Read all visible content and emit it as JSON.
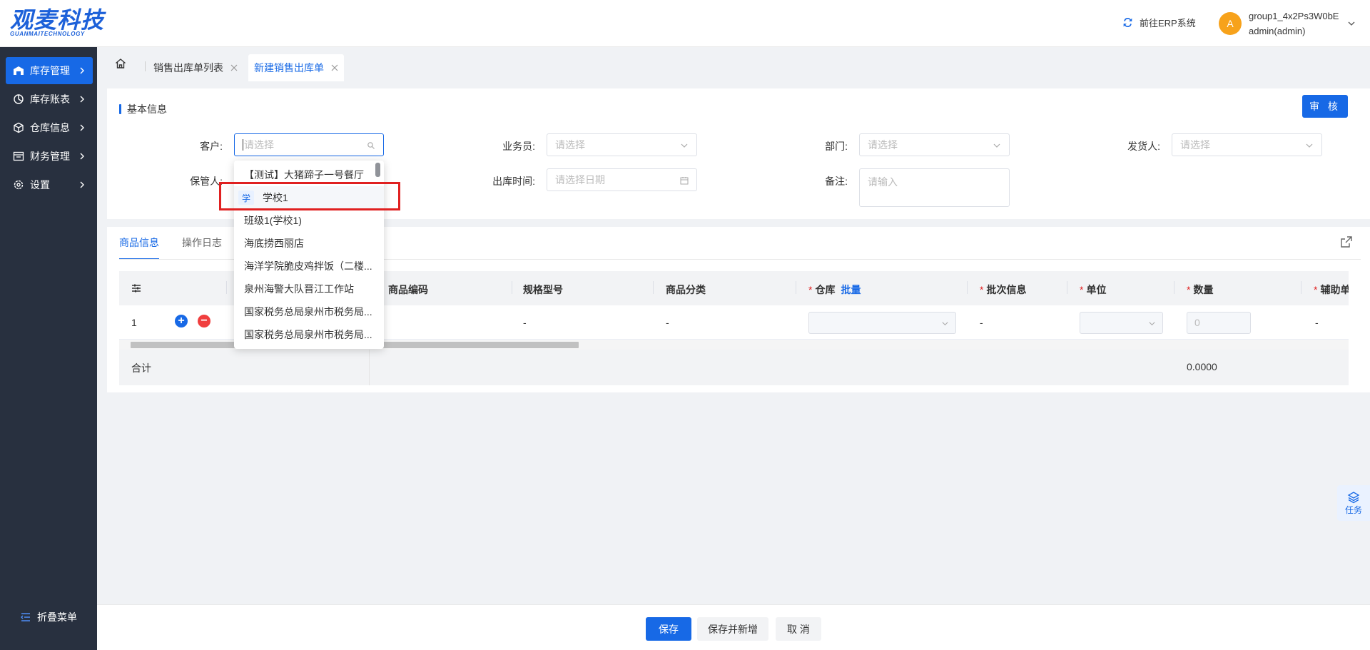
{
  "header": {
    "logo_text": "观麦科技",
    "logo_sub": "GUANMAITECHNOLOGY",
    "erp_link": "前往ERP系统",
    "avatar_letter": "A",
    "user_group": "group1_4x2Ps3W0bE",
    "user_name": "admin(admin)"
  },
  "sidebar": {
    "items": [
      {
        "label": "库存管理",
        "icon": "warehouse-icon",
        "active": true
      },
      {
        "label": "库存账表",
        "icon": "pie-chart-icon",
        "active": false
      },
      {
        "label": "仓库信息",
        "icon": "cube-icon",
        "active": false
      },
      {
        "label": "财务管理",
        "icon": "finance-icon",
        "active": false
      },
      {
        "label": "设置",
        "icon": "gear-icon",
        "active": false
      }
    ],
    "collapse_label": "折叠菜单"
  },
  "tabs": [
    {
      "label": "销售出库单列表",
      "active": false
    },
    {
      "label": "新建销售出库单",
      "active": true
    }
  ],
  "basic_info": {
    "title": "基本信息",
    "audit_button": "审 核",
    "fields": {
      "customer_label": "客户:",
      "customer_placeholder": "请选择",
      "salesman_label": "业务员:",
      "salesman_placeholder": "请选择",
      "department_label": "部门:",
      "department_placeholder": "请选择",
      "shipper_label": "发货人:",
      "shipper_placeholder": "请选择",
      "keeper_label": "保管人:",
      "outtime_label": "出库时间:",
      "outtime_placeholder": "请选择日期",
      "remark_label": "备注:",
      "remark_placeholder": "请输入"
    }
  },
  "customer_dropdown": {
    "options": [
      {
        "label": "【测试】大猪蹄子一号餐厅",
        "badge": ""
      },
      {
        "label": "学校1",
        "badge": "学"
      },
      {
        "label": "班级1(学校1)",
        "badge": ""
      },
      {
        "label": "海底捞西丽店",
        "badge": ""
      },
      {
        "label": "海洋学院脆皮鸡拌饭（二楼...",
        "badge": ""
      },
      {
        "label": "泉州海警大队晋江工作站",
        "badge": ""
      },
      {
        "label": "国家税务总局泉州市税务局...",
        "badge": ""
      },
      {
        "label": "国家税务总局泉州市税务局...",
        "badge": ""
      }
    ]
  },
  "goods": {
    "tabs": [
      "商品信息",
      "操作日志"
    ],
    "columns": {
      "code": "商品编码",
      "spec": "规格型号",
      "category": "商品分类",
      "warehouse": "仓库",
      "batch_link": "批量",
      "batch_info": "批次信息",
      "unit": "单位",
      "quantity": "数量",
      "aux": "辅助单"
    },
    "row": {
      "index": "1",
      "spec": "-",
      "category": "-",
      "batch_info": "-",
      "quantity_placeholder": "0",
      "aux": "-"
    },
    "footer": {
      "total_label": "合计",
      "total_qty": "0.0000"
    }
  },
  "footer": {
    "save": "保存",
    "save_new": "保存并新增",
    "cancel": "取 消"
  },
  "task_label": "任务",
  "colors": {
    "primary": "#1769e6",
    "sidebar_bg": "#28303f",
    "highlight": "#e02020",
    "add_btn": "#1769e6",
    "remove_btn": "#f03e3e"
  }
}
